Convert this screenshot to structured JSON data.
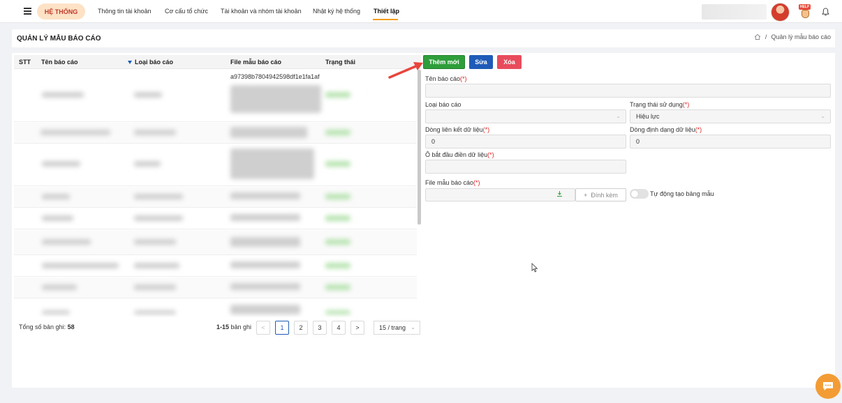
{
  "nav": {
    "brand": "HỆ THỐNG",
    "items": [
      "Thông tin tài khoản",
      "Cơ cấu tổ chức",
      "Tài khoản và nhóm tài khoản",
      "Nhật ký hệ thống",
      "Thiết lập"
    ],
    "active_item": "Thiết lập",
    "help_badge": "HELP"
  },
  "page": {
    "title": "QUẢN LÝ MẪU BÁO CÁO",
    "breadcrumb_current": "Quản lý mẫu báo cáo",
    "breadcrumb_separator": "/"
  },
  "table": {
    "columns": [
      "STT",
      "Tên báo cáo",
      "Loại báo cáo",
      "File mẫu báo cáo",
      "Trạng thái"
    ],
    "first_row_file": "a97398b7804942598df1e1fa1af"
  },
  "pagination": {
    "total_label": "Tổng số bản ghi:",
    "total": "58",
    "range": "1-15",
    "range_suffix": "bản ghi",
    "prev": "<",
    "next": ">",
    "pages": [
      "1",
      "2",
      "3",
      "4"
    ],
    "current_page": "1",
    "page_size": "15 / trang"
  },
  "actions": {
    "add": "Thêm mới",
    "edit": "Sửa",
    "delete": "Xóa"
  },
  "form": {
    "required_mark": "(*)",
    "report_name_label": "Tên báo cáo",
    "report_type_label": "Loại báo cáo",
    "status_label": "Trạng thái sử dụng",
    "status_value": "Hiệu lực",
    "link_row_label": "Dòng liên kết dữ liệu",
    "link_row_value": "0",
    "format_row_label": "Dòng định dạng dữ liệu",
    "format_row_value": "0",
    "start_cell_label": "Ô bắt đầu điền dữ liệu",
    "template_file_label": "File mẫu báo cáo",
    "attach_label": "Đính kèm",
    "attach_plus": "+",
    "auto_create_label": "Tự động tạo bảng mẫu"
  },
  "colors": {
    "accent": "#f39c12",
    "add_button": "#2e9e3a",
    "edit_button": "#1e5bb8",
    "delete_button": "#e84c5c",
    "arrow": "#e8453c"
  }
}
